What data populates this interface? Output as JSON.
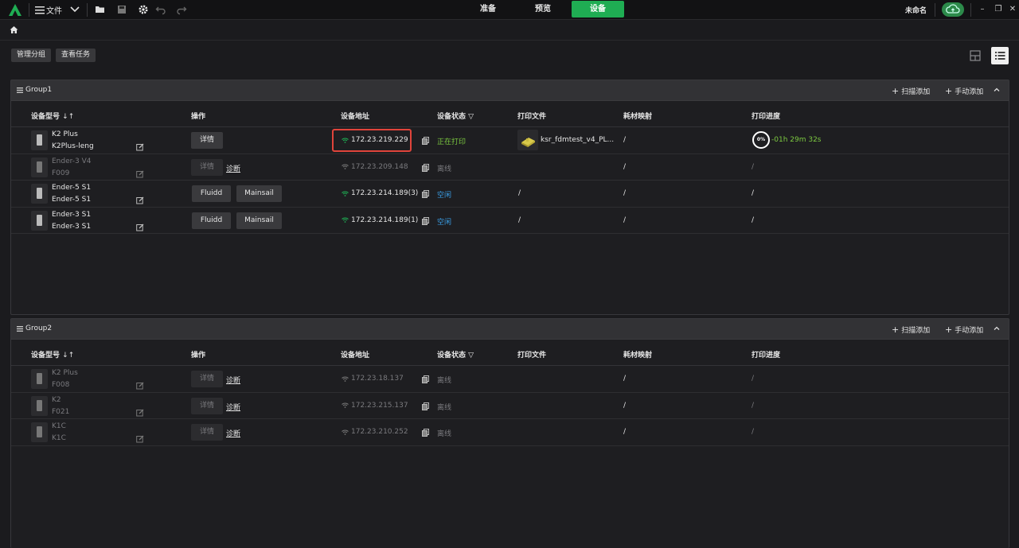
{
  "topbar": {
    "menu_label": "文件",
    "tabs": [
      "准备",
      "预览",
      "设备"
    ],
    "active_tab": "设备",
    "project_name": "未命名"
  },
  "toolbar": {
    "manage_groups": "管理分组",
    "view_tasks": "查看任务"
  },
  "columns": {
    "model": "设备型号",
    "actions": "操作",
    "address": "设备地址",
    "status": "设备状态",
    "file": "打印文件",
    "material": "耗材映射",
    "progress": "打印进度"
  },
  "group_buttons": {
    "scan_add": "扫描添加",
    "manual_add": "手动添加"
  },
  "groups": [
    {
      "name": "Group1",
      "devices": [
        {
          "model": "K2 Plus",
          "name": "K2Plus-leng",
          "online": true,
          "buttons": [
            "详情"
          ],
          "address": "172.23.219.229",
          "status": "正在打印",
          "file": "ksr_fdmtest_v4_PL...",
          "material": "/",
          "progress_percent": "0%",
          "remaining": "-01h 29m 32s"
        },
        {
          "model": "Ender-3 V4",
          "name": "F009",
          "online": false,
          "buttons": [
            "详情"
          ],
          "diagnose": "诊断",
          "address": "172.23.209.148",
          "status": "离线",
          "file": "",
          "material": "/",
          "progress": "/"
        },
        {
          "model": "Ender-5 S1",
          "name": "Ender-5 S1",
          "online": true,
          "buttons": [
            "Fluidd",
            "Mainsail"
          ],
          "address": "172.23.214.189(3)",
          "status": "空闲",
          "file": "/",
          "material": "/",
          "progress": "/"
        },
        {
          "model": "Ender-3 S1",
          "name": "Ender-3 S1",
          "online": true,
          "buttons": [
            "Fluidd",
            "Mainsail"
          ],
          "address": "172.23.214.189(1)",
          "status": "空闲",
          "file": "/",
          "material": "/",
          "progress": "/"
        }
      ]
    },
    {
      "name": "Group2",
      "devices": [
        {
          "model": "K2 Plus",
          "name": "F008",
          "online": false,
          "buttons": [
            "详情"
          ],
          "diagnose": "诊断",
          "address": "172.23.18.137",
          "status": "离线",
          "file": "",
          "material": "/",
          "progress": "/"
        },
        {
          "model": "K2",
          "name": "F021",
          "online": false,
          "buttons": [
            "详情"
          ],
          "diagnose": "诊断",
          "address": "172.23.215.137",
          "status": "离线",
          "file": "",
          "material": "/",
          "progress": "/"
        },
        {
          "model": "K1C",
          "name": "K1C",
          "online": false,
          "buttons": [
            "详情"
          ],
          "diagnose": "诊断",
          "address": "172.23.210.252",
          "status": "离线",
          "file": "",
          "material": "/",
          "progress": "/"
        }
      ]
    }
  ],
  "colors": {
    "accent_green": "#1fad53",
    "printing_green": "#7cc940",
    "idle_blue": "#3aa0e8",
    "offline_gray": "#7a7a7e",
    "highlight_red": "#e0443b"
  }
}
